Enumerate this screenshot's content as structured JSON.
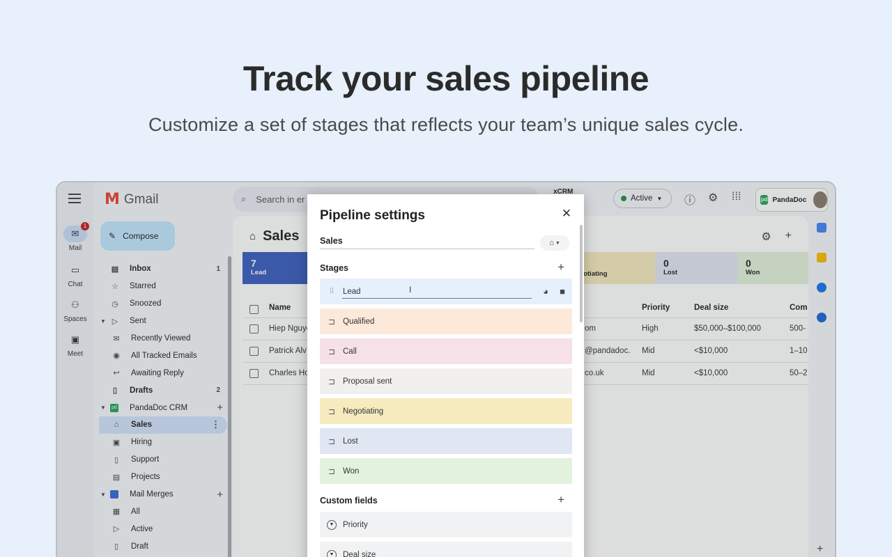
{
  "hero": {
    "title": "Track your sales pipeline",
    "subtitle": "Customize a set of stages that reflects your team’s unique sales cycle."
  },
  "rail": {
    "items": [
      {
        "label": "Mail",
        "icon": "mail-icon",
        "badge": "1"
      },
      {
        "label": "Chat",
        "icon": "chat-icon"
      },
      {
        "label": "Spaces",
        "icon": "spaces-icon"
      },
      {
        "label": "Meet",
        "icon": "meet-icon"
      }
    ]
  },
  "app": {
    "name": "Gmail",
    "logo": "M"
  },
  "search": {
    "placeholder": "Search in er"
  },
  "compose": {
    "label": "Compose"
  },
  "nav": {
    "items": [
      {
        "label": "Inbox",
        "count": "1"
      },
      {
        "label": "Starred"
      },
      {
        "label": "Snoozed"
      },
      {
        "label": "Sent"
      },
      {
        "label": "Recently Viewed"
      },
      {
        "label": "All Tracked Emails"
      },
      {
        "label": "Awaiting Reply"
      },
      {
        "label": "Drafts",
        "count": "2"
      },
      {
        "label": "PandaDoc CRM"
      },
      {
        "label": "Sales"
      },
      {
        "label": "Hiring"
      },
      {
        "label": "Support"
      },
      {
        "label": "Projects"
      },
      {
        "label": "Mail Merges"
      },
      {
        "label": "All"
      },
      {
        "label": "Active"
      },
      {
        "label": "Draft"
      }
    ]
  },
  "main": {
    "title": "Sales",
    "stage_cards": [
      {
        "count": "7",
        "label": "Lead",
        "color": "#3a5fc0"
      },
      {
        "count": "",
        "label": "egotiating",
        "color": "#f6ebbf"
      },
      {
        "count": "0",
        "label": "Lost",
        "color": "#e1e6f3"
      },
      {
        "count": "0",
        "label": "Won",
        "color": "#e3f2dc"
      }
    ],
    "columns": [
      "Name",
      "Priority",
      "Deal size",
      "Com"
    ],
    "rows": [
      {
        "name": "Hiep Nguye",
        "email": "om",
        "priority": "High",
        "deal": "$50,000–$100,000",
        "company": "500-"
      },
      {
        "name": "Patrick Alv",
        "email": "@pandadoc.",
        "priority": "Mid",
        "deal": "<$10,000",
        "company": "1–10"
      },
      {
        "name": "Charles Ho",
        "email": "co.uk",
        "priority": "Mid",
        "deal": "<$10,000",
        "company": "50–2"
      }
    ]
  },
  "topbar": {
    "crm_label": "xCRM",
    "status": "Active",
    "pandadoc": "PandaDoc"
  },
  "modal": {
    "title": "Pipeline settings",
    "pipeline_name": "Sales",
    "stages_heading": "Stages",
    "stages": [
      {
        "label": "Lead",
        "color": "#e6f0fc"
      },
      {
        "label": "Qualified",
        "color": "#fde9da"
      },
      {
        "label": "Call",
        "color": "#f6e1e8"
      },
      {
        "label": "Proposal sent",
        "color": "#f2f0ee"
      },
      {
        "label": "Negotiating",
        "color": "#f6ebbf"
      },
      {
        "label": "Lost",
        "color": "#e1e6f3"
      },
      {
        "label": "Won",
        "color": "#e3f2dc"
      }
    ],
    "custom_fields_heading": "Custom fields",
    "custom_fields": [
      "Priority",
      "Deal size"
    ]
  }
}
